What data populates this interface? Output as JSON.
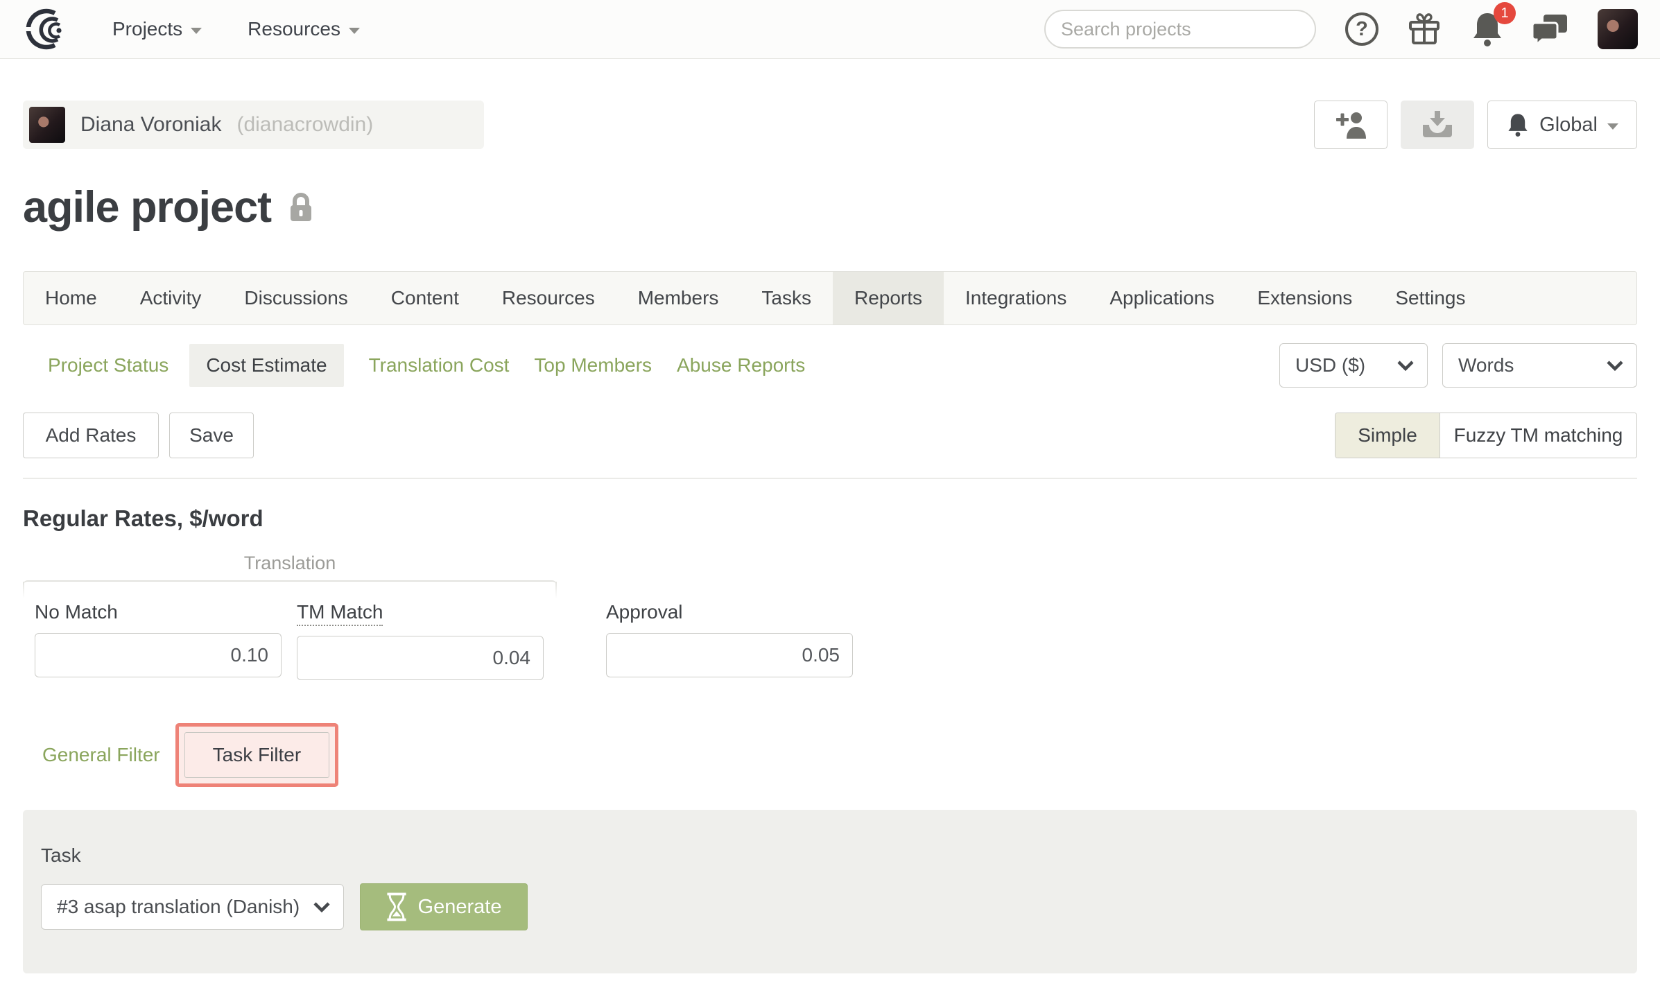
{
  "topbar": {
    "nav": [
      {
        "label": "Projects"
      },
      {
        "label": "Resources"
      }
    ],
    "search_placeholder": "Search projects",
    "notification_count": "1"
  },
  "icons": {
    "help_glyph": "?"
  },
  "user": {
    "name": "Diana Voroniak",
    "username": "(dianacrowdin)"
  },
  "header": {
    "project_title": "agile project",
    "global_label": "Global"
  },
  "tabs": {
    "items": [
      "Home",
      "Activity",
      "Discussions",
      "Content",
      "Resources",
      "Members",
      "Tasks",
      "Reports",
      "Integrations",
      "Applications",
      "Extensions",
      "Settings"
    ],
    "active": "Reports"
  },
  "subtabs": {
    "items": [
      "Project Status",
      "Cost Estimate",
      "Translation Cost",
      "Top Members",
      "Abuse Reports"
    ],
    "active": "Cost Estimate",
    "currency": "USD ($)",
    "unit": "Words"
  },
  "toolbar": {
    "add_rates_label": "Add Rates",
    "save_label": "Save",
    "simple_label": "Simple",
    "fuzzy_label": "Fuzzy TM matching"
  },
  "rates": {
    "heading": "Regular Rates, $/word",
    "group_label": "Translation",
    "fields": [
      {
        "label": "No Match",
        "value": "0.10"
      },
      {
        "label": "TM Match",
        "value": "0.04"
      },
      {
        "label": "Approval",
        "value": "0.05"
      }
    ]
  },
  "filters": {
    "general_label": "General Filter",
    "task_label": "Task Filter"
  },
  "task_section": {
    "label": "Task",
    "selected_task": "#3 asap translation (Danish)",
    "generate_label": "Generate"
  },
  "colors": {
    "link_green": "#8aa55c",
    "generate_green": "#a5bc7d",
    "highlight_red": "#ee8277",
    "badge_red": "#e5483d",
    "active_tab_bg": "#e9e9e3",
    "simple_toggle_bg": "#eeedde"
  }
}
